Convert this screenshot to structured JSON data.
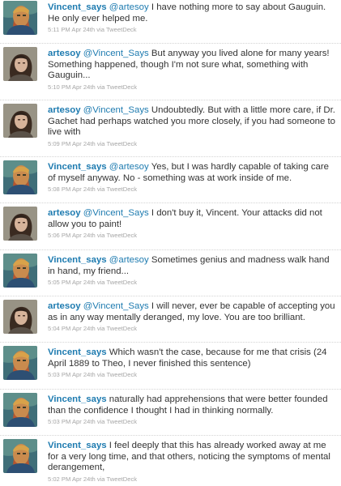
{
  "colors": {
    "link": "#1e7bb0",
    "text": "#333333",
    "meta": "#a6a6a6",
    "divider": "#d4d4d4"
  },
  "tweets": [
    {
      "user": "Vincent_says",
      "mention": "@artesoy",
      "text": "I have nothing more to say about Gauguin. He only ever helped me.",
      "time": "5:11 PM Apr 24th",
      "via": "via",
      "app": "TweetDeck",
      "avatar": "vangogh-avatar-icon"
    },
    {
      "user": "artesoy",
      "mention": "@Vincent_Says",
      "text": "But anyway you lived alone for many years! Something happened, though I'm not sure what, something with Gauguin...",
      "time": "5:10 PM Apr 24th",
      "via": "via",
      "app": "TweetDeck",
      "avatar": "artesoy-avatar-icon"
    },
    {
      "user": "artesoy",
      "mention": "@Vincent_Says",
      "text": "Undoubtedly. But with a little more care, if Dr. Gachet had perhaps watched you more closely, if you had someone to live with",
      "time": "5:09 PM Apr 24th",
      "via": "via",
      "app": "TweetDeck",
      "avatar": "artesoy-avatar-icon"
    },
    {
      "user": "Vincent_says",
      "mention": "@artesoy",
      "text": "Yes, but I was hardly capable of taking care of myself anyway. No - something was at work inside of me.",
      "time": "5:08 PM Apr 24th",
      "via": "via",
      "app": "TweetDeck",
      "avatar": "vangogh-avatar-icon"
    },
    {
      "user": "artesoy",
      "mention": "@Vincent_Says",
      "text": "I don't buy it, Vincent. Your attacks did not allow you to paint!",
      "time": "5:06 PM Apr 24th",
      "via": "via",
      "app": "TweetDeck",
      "avatar": "artesoy-avatar-icon"
    },
    {
      "user": "Vincent_says",
      "mention": "@artesoy",
      "text": "Sometimes genius and madness walk hand in hand, my friend...",
      "time": "5:05 PM Apr 24th",
      "via": "via",
      "app": "TweetDeck",
      "avatar": "vangogh-avatar-icon"
    },
    {
      "user": "artesoy",
      "mention": "@Vincent_Says",
      "text": "I will never, ever be capable of accepting you as in any way mentally deranged, my love. You are too brilliant.",
      "time": "5:04 PM Apr 24th",
      "via": "via",
      "app": "TweetDeck",
      "avatar": "artesoy-avatar-icon"
    },
    {
      "user": "Vincent_says",
      "mention": "",
      "text": "Which wasn't the case, because for me that crisis (24 April 1889 to Theo, I never finished this sentence)",
      "time": "5:03 PM Apr 24th",
      "via": "via",
      "app": "TweetDeck",
      "avatar": "vangogh-avatar-icon"
    },
    {
      "user": "Vincent_says",
      "mention": "",
      "text": "naturally had apprehensions that were better founded than the confidence I thought I had in thinking normally.",
      "time": "5:03 PM Apr 24th",
      "via": "via",
      "app": "TweetDeck",
      "avatar": "vangogh-avatar-icon"
    },
    {
      "user": "Vincent_says",
      "mention": "",
      "text": "I feel deeply that this has already worked away at me for a very long time, and that others, noticing the symptoms of mental derangement,",
      "time": "5:02 PM Apr 24th",
      "via": "via",
      "app": "TweetDeck",
      "avatar": "vangogh-avatar-icon"
    }
  ]
}
